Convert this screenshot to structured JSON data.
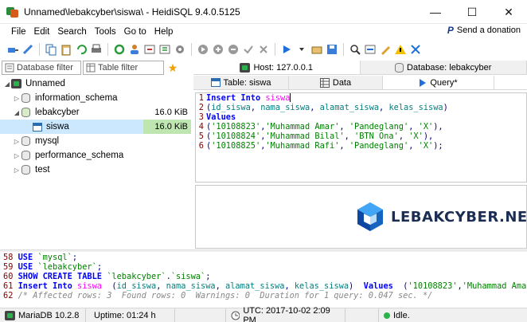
{
  "window": {
    "title": "Unnamed\\lebakcyber\\siswa\\ - HeidiSQL 9.4.0.5125",
    "minimize_glyph": "—",
    "maximize_glyph": "☐",
    "close_glyph": "✕"
  },
  "menu": {
    "items": [
      "File",
      "Edit",
      "Search",
      "Tools",
      "Go to",
      "Help"
    ],
    "donation_icon_text": "P",
    "donation_label": "Send a donation"
  },
  "toolbar": {
    "icons": [
      "connect-icon",
      "disconnect-icon",
      "copy-icon",
      "paste-icon",
      "undo-icon",
      "print-icon",
      "refresh-icon",
      "user-manager-icon",
      "import-icon",
      "export-icon",
      "maintenance-icon",
      "first-icon",
      "add-icon",
      "remove-icon",
      "apply-icon",
      "cancel-icon",
      "run-icon",
      "query-options-icon",
      "load-sql-icon",
      "save-sql-icon",
      "search-icon",
      "replace-icon",
      "format-icon",
      "warning-icon",
      "help-icon"
    ]
  },
  "left_panel": {
    "database_filter_placeholder": "Database filter",
    "table_filter_placeholder": "Table filter",
    "tree": [
      {
        "label": "Unnamed",
        "level": 0,
        "expanded": true,
        "type": "server",
        "size": ""
      },
      {
        "label": "information_schema",
        "level": 1,
        "expanded": false,
        "type": "database",
        "size": ""
      },
      {
        "label": "lebakcyber",
        "level": 1,
        "expanded": true,
        "type": "database",
        "size": "16.0 KiB"
      },
      {
        "label": "siswa",
        "level": 2,
        "expanded": null,
        "type": "table",
        "size": "16.0 KiB",
        "selected": true
      },
      {
        "label": "mysql",
        "level": 1,
        "expanded": false,
        "type": "database",
        "size": ""
      },
      {
        "label": "performance_schema",
        "level": 1,
        "expanded": false,
        "type": "database",
        "size": ""
      },
      {
        "label": "test",
        "level": 1,
        "expanded": false,
        "type": "database",
        "size": ""
      }
    ]
  },
  "tabs": {
    "host": "Host: 127.0.0.1",
    "database": "Database: lebakcyber",
    "table": "Table: siswa",
    "data": "Data",
    "query": "Query*"
  },
  "editor": {
    "lines": [
      {
        "n": "1",
        "parts": [
          {
            "t": "Insert Into ",
            "c": "kw"
          },
          {
            "t": "siswa",
            "c": "tblname"
          }
        ]
      },
      {
        "n": "2",
        "parts": [
          {
            "t": "(",
            "c": "punct"
          },
          {
            "t": "id_siswa",
            "c": "col"
          },
          {
            "t": ", ",
            "c": "punct"
          },
          {
            "t": "nama_siswa",
            "c": "col"
          },
          {
            "t": ", ",
            "c": "punct"
          },
          {
            "t": "alamat_siswa",
            "c": "col"
          },
          {
            "t": ", ",
            "c": "punct"
          },
          {
            "t": "kelas_siswa",
            "c": "col"
          },
          {
            "t": ")",
            "c": "punct"
          }
        ]
      },
      {
        "n": "3",
        "parts": [
          {
            "t": "Values",
            "c": "kw"
          }
        ]
      },
      {
        "n": "4",
        "parts": [
          {
            "t": "(",
            "c": "punct"
          },
          {
            "t": "'10108823'",
            "c": "str"
          },
          {
            "t": ",",
            "c": "punct"
          },
          {
            "t": "'Muhammad Amar'",
            "c": "str"
          },
          {
            "t": ", ",
            "c": "punct"
          },
          {
            "t": "'Pandeglang'",
            "c": "str"
          },
          {
            "t": ", ",
            "c": "punct"
          },
          {
            "t": "'X'",
            "c": "str"
          },
          {
            "t": "),",
            "c": "punct"
          }
        ]
      },
      {
        "n": "5",
        "parts": [
          {
            "t": "(",
            "c": "punct"
          },
          {
            "t": "'10108824'",
            "c": "str"
          },
          {
            "t": ",",
            "c": "punct"
          },
          {
            "t": "'Muhammad Bilal'",
            "c": "str"
          },
          {
            "t": ", ",
            "c": "punct"
          },
          {
            "t": "'BTN Ona'",
            "c": "str"
          },
          {
            "t": ", ",
            "c": "punct"
          },
          {
            "t": "'X'",
            "c": "str"
          },
          {
            "t": "),",
            "c": "punct"
          }
        ]
      },
      {
        "n": "6",
        "parts": [
          {
            "t": "(",
            "c": "punct"
          },
          {
            "t": "'10108825'",
            "c": "str"
          },
          {
            "t": ",",
            "c": "punct"
          },
          {
            "t": "'Muhammad Rafi'",
            "c": "str"
          },
          {
            "t": ", ",
            "c": "punct"
          },
          {
            "t": "'Pandeglang'",
            "c": "str"
          },
          {
            "t": ", ",
            "c": "punct"
          },
          {
            "t": "'X'",
            "c": "str"
          },
          {
            "t": ");",
            "c": "punct"
          }
        ]
      }
    ]
  },
  "watermark": {
    "text": "LEBAKCYBER.NET",
    "color": "#1c2d54",
    "accent": "#1565c0"
  },
  "log": {
    "lines": [
      {
        "n": "58",
        "parts": [
          {
            "t": " USE ",
            "c": "kw"
          },
          {
            "t": "`mysql`",
            "c": "str"
          },
          {
            "t": ";",
            "c": "punct"
          }
        ]
      },
      {
        "n": "59",
        "parts": [
          {
            "t": " USE ",
            "c": "kw"
          },
          {
            "t": "`lebakcyber`",
            "c": "str"
          },
          {
            "t": ";",
            "c": "punct"
          }
        ]
      },
      {
        "n": "60",
        "parts": [
          {
            "t": " SHOW CREATE TABLE ",
            "c": "kw"
          },
          {
            "t": "`lebakcyber`",
            "c": "str"
          },
          {
            "t": ".",
            "c": "punct"
          },
          {
            "t": "`siswa`",
            "c": "str"
          },
          {
            "t": ";",
            "c": "punct"
          }
        ]
      },
      {
        "n": "61",
        "parts": [
          {
            "t": " Insert Into ",
            "c": "kw"
          },
          {
            "t": "siswa",
            "c": "tblname"
          },
          {
            "t": "  (",
            "c": "punct"
          },
          {
            "t": "id_siswa",
            "c": "col"
          },
          {
            "t": ", ",
            "c": "punct"
          },
          {
            "t": "nama_siswa",
            "c": "col"
          },
          {
            "t": ", ",
            "c": "punct"
          },
          {
            "t": "alamat_siswa",
            "c": "col"
          },
          {
            "t": ", ",
            "c": "punct"
          },
          {
            "t": "kelas_siswa",
            "c": "col"
          },
          {
            "t": ")  ",
            "c": "punct"
          },
          {
            "t": "Values",
            "c": "kw"
          },
          {
            "t": "  (",
            "c": "punct"
          },
          {
            "t": "'10108823'",
            "c": "str"
          },
          {
            "t": ",",
            "c": "punct"
          },
          {
            "t": "'Muhammad Amar",
            "c": "str"
          }
        ]
      },
      {
        "n": "62",
        "parts": [
          {
            "t": " /* Affected rows: 3  Found rows: 0  Warnings: 0  Duration for 1 query: 0.047 sec. */",
            "c": "comment"
          }
        ]
      }
    ]
  },
  "status": {
    "server": "MariaDB 10.2.8",
    "uptime": "Uptime: 01:24 h",
    "time": "UTC: 2017-10-02 2:09 PM",
    "state": "Idle."
  }
}
